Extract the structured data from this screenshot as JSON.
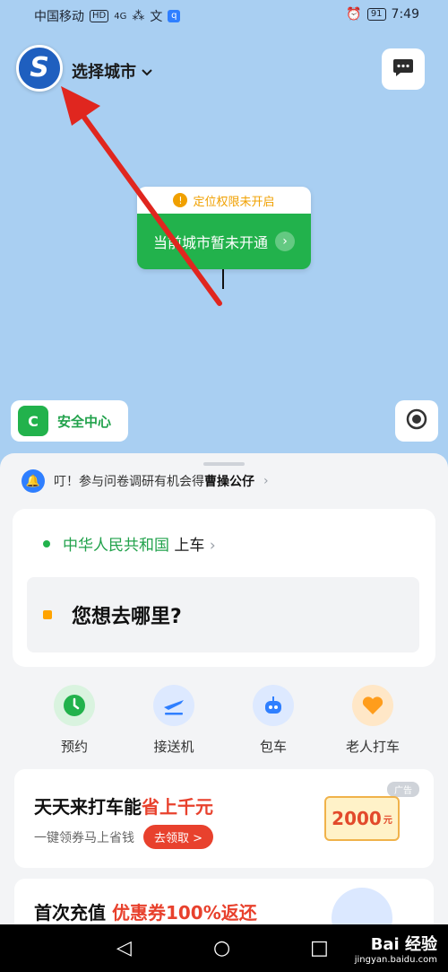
{
  "status_bar": {
    "carrier": "中国移动",
    "hd": "HD",
    "signal": "4G",
    "ai": "文",
    "battery": "91",
    "time": "7:49"
  },
  "header": {
    "logo_letter": "S",
    "city_select": "选择城市",
    "chevron": "⌄"
  },
  "location_card": {
    "warning_icon": "!",
    "warning": "定位权限未开启",
    "message": "当前城市暂未开通",
    "arrow": "›"
  },
  "map_buttons": {
    "safety_center": "安全中心",
    "shield_letter": "C"
  },
  "sheet": {
    "notice_prefix": "叮！参与问卷调研有机会得",
    "notice_highlight": "曹操公仔",
    "notice_chevron": "›",
    "from_location": "中华人民共和国",
    "from_suffix": "上车",
    "from_chevron": "›",
    "to_placeholder": "您想去哪里?",
    "services": [
      {
        "label": "预约",
        "icon": "clock-icon"
      },
      {
        "label": "接送机",
        "icon": "plane-icon"
      },
      {
        "label": "包车",
        "icon": "robot-icon"
      },
      {
        "label": "老人打车",
        "icon": "heart-hands-icon"
      }
    ],
    "promo1": {
      "title_prefix": "天天来打车能",
      "title_highlight": "省上千元",
      "subtitle": "一键领券马上省钱",
      "cta": "去领取 >",
      "ad_tag": "广告",
      "coupon_value": "2000",
      "coupon_unit": "元"
    },
    "promo2": {
      "title_prefix": "首次充值 ",
      "title_highlight": "优惠券100%返还"
    }
  },
  "nav_bar": {
    "back": "◁",
    "home": "○",
    "recent": "□"
  },
  "watermark": {
    "brand": "Bai 经验",
    "domain": "jingyan.baidu.com"
  },
  "colors": {
    "map": "#a9cff2",
    "accent_green": "#22b24c",
    "accent_red": "#e8412d",
    "accent_orange": "#ffa300",
    "arrow": "#e0261f"
  }
}
